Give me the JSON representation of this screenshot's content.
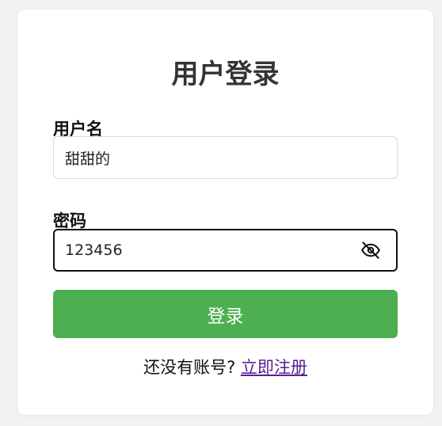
{
  "login": {
    "title": "用户登录",
    "username_label": "用户名",
    "username_value": "甜甜的",
    "password_label": "密码",
    "password_value": "123456",
    "password_toggle_icon": "eye-off-icon",
    "submit_label": "登录",
    "register_prompt": "还没有账号?",
    "register_link": "立即注册"
  },
  "colors": {
    "background": "#f2f2f2",
    "card": "#ffffff",
    "title": "#333333",
    "button": "#4caf50",
    "link": "#5a1e94"
  }
}
